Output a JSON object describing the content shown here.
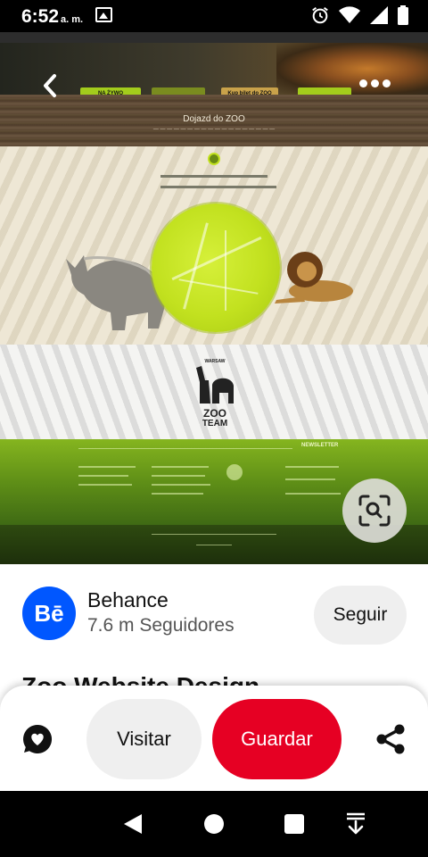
{
  "status_bar": {
    "time": "6:52",
    "ampm": "a. m."
  },
  "pin_image": {
    "website": {
      "hero_button_1": "NA ŻYWO",
      "hero_button_2": "Kup bilet do ZOO",
      "section_title": "Dojazd do ZOO",
      "team_logo_top": "WARSAW",
      "team_logo_zoo": "ZOO",
      "team_logo_bottom": "TEAM",
      "newsletter": "NEWSLETTER"
    }
  },
  "creator": {
    "name": "Behance",
    "logo_text": "Bē",
    "followers": "7.6 m Seguidores",
    "follow_label": "Seguir"
  },
  "pin": {
    "title": "Zoo Website Design"
  },
  "actions": {
    "visit_label": "Visitar",
    "save_label": "Guardar"
  },
  "colors": {
    "save_red": "#e60023",
    "behance_blue": "#0057ff"
  },
  "icons": {
    "react": "heart-chat-icon",
    "share": "share-icon",
    "lens": "visual-search-icon",
    "back": "chevron-left-icon",
    "more": "more-dots-icon"
  }
}
